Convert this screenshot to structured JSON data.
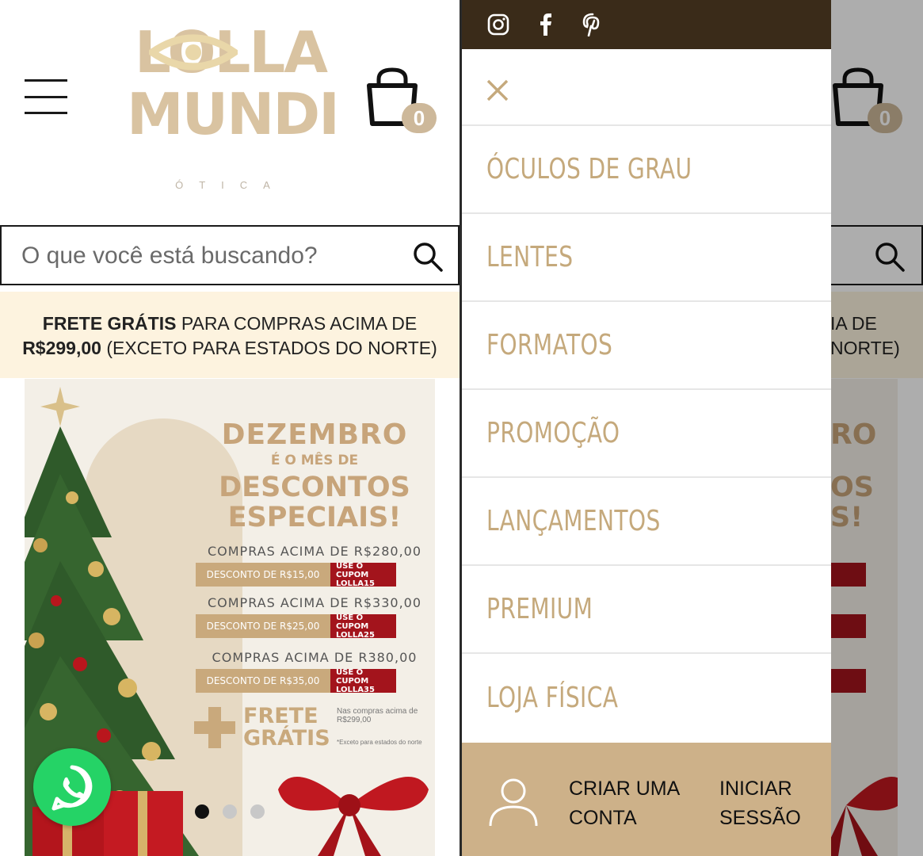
{
  "store": {
    "brand_logo_top": "LOLLA",
    "brand_logo_bottom": "MUNDI",
    "brand_logo_sub": "ÓTICA",
    "cart_count": "0",
    "search": {
      "placeholder": "O que você está buscando?"
    },
    "shipping": {
      "bold_1": "FRETE GRÁTIS",
      "text_1": " PARA COMPRAS ACIMA DE",
      "bold_2": "R$299,00",
      "text_2": " (EXCETO PARA ESTADOS DO NORTE)"
    },
    "banner": {
      "headline_1": "DEZEMBRO",
      "headline_2": "É O MÊS DE",
      "headline_3": "DESCONTOS",
      "headline_4": "ESPECIAIS!",
      "tiers": [
        {
          "title": "COMPRAS ACIMA DE R$280,00",
          "discount": "DESCONTO DE R$15,00",
          "coupon_label": "USE O CUPOM",
          "coupon_code": "LOLLA15"
        },
        {
          "title": "COMPRAS ACIMA DE R$330,00",
          "discount": "DESCONTO DE R$25,00",
          "coupon_label": "USE O CUPOM",
          "coupon_code": "LOLLA25"
        },
        {
          "title": "COMPRAS ACIMA DE R380,00",
          "discount": "DESCONTO DE R$35,00",
          "coupon_label": "USE O CUPOM",
          "coupon_code": "LOLLA35"
        }
      ],
      "frete_1": "FRETE",
      "frete_2": "GRÁTIS",
      "frete_note": "Nas compras acima de R$299,00",
      "frete_note_2": "*Exceto para estados do norte"
    },
    "carousel": {
      "total": 3,
      "active_index": 0
    }
  },
  "drawer": {
    "social": [
      "instagram-icon",
      "facebook-icon",
      "pinterest-icon"
    ],
    "menu": [
      {
        "label": "ÓCULOS DE GRAU"
      },
      {
        "label": "LENTES"
      },
      {
        "label": "FORMATOS"
      },
      {
        "label": "PROMOÇÃO"
      },
      {
        "label": "LANÇAMENTOS"
      },
      {
        "label": "PREMIUM"
      },
      {
        "label": "LOJA FÍSICA"
      }
    ],
    "account": {
      "create_1": "CRIAR UMA",
      "create_2": "CONTA",
      "login_1": "INICIAR",
      "login_2": "SESSÃO"
    }
  },
  "colors": {
    "brand_gold": "#c5a97c",
    "social_bar": "#3a2b19",
    "account_bar": "#cdb189",
    "shipping_bg": "#fdf3df",
    "whatsapp": "#25d366"
  },
  "peek": {
    "shipping_1": "IA DE",
    "shipping_2": "NORTE)",
    "banner_1": "RO",
    "banner_2": "OS",
    "banner_3": "S!"
  }
}
